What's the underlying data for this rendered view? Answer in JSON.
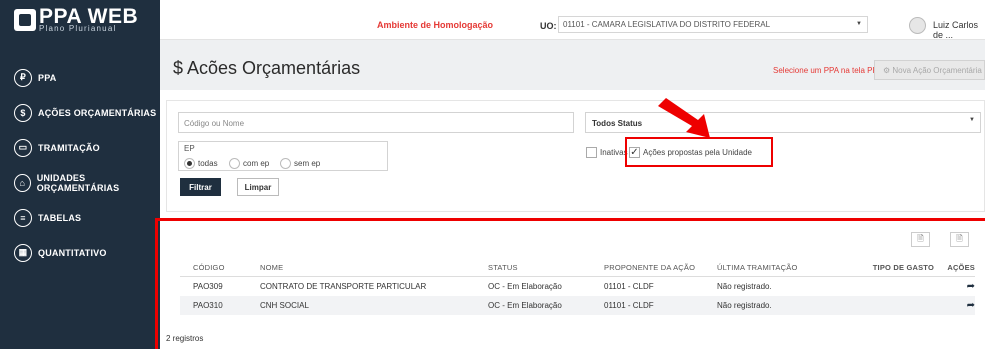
{
  "app": {
    "logo_main": "PPA WEB",
    "logo_sub": "Plano Plurianual"
  },
  "sidebar": {
    "items": [
      {
        "label": "PPA",
        "icon": "ppa-icon"
      },
      {
        "label": "AÇÕES ORÇAMENTÁRIAS",
        "icon": "dollar-icon"
      },
      {
        "label": "TRAMITAÇÃO",
        "icon": "tramitacao-icon"
      },
      {
        "label": "UNIDADES ORÇAMENTÁRIAS",
        "icon": "institution-icon"
      },
      {
        "label": "TABELAS",
        "icon": "list-icon"
      },
      {
        "label": "QUANTITATIVO",
        "icon": "chart-icon"
      }
    ]
  },
  "topbar": {
    "environment": "Ambiente de Homologação",
    "uo_label": "UO:",
    "uo_value": "01101 - CAMARA LEGISLATIVA DO DISTRITO FEDERAL",
    "user_name": "Luiz Carlos de ..."
  },
  "header": {
    "title": "$ Acões Orçamentárias",
    "hint": "Selecione um PPA na tela PPA",
    "new_action": "⚙ Nova Ação Orçamentária"
  },
  "filters": {
    "code_placeholder": "Código ou Nome",
    "status_value": "Todos Status",
    "ep_label": "EP",
    "ep_options": [
      "todas",
      "com ep",
      "sem ep"
    ],
    "ep_selected": "todas",
    "inactive_label": "Inativas",
    "proposed_label": "Ações propostas pela Unidade",
    "filter_button": "Filtrar",
    "clear_button": "Limpar"
  },
  "table": {
    "headers": [
      "CÓDIGO",
      "NOME",
      "STATUS",
      "PROPONENTE DA AÇÃO",
      "ÚLTIMA TRAMITAÇÃO",
      "TIPO DE GASTO",
      "AÇÕES"
    ],
    "rows": [
      {
        "code": "PAO309",
        "name": "CONTRATO DE TRANSPORTE PARTICULAR",
        "status": "OC - Em Elaboração",
        "proponent": "01101 - CLDF",
        "last": "Não registrado.",
        "type": ""
      },
      {
        "code": "PAO310",
        "name": "CNH SOCIAL",
        "status": "OC - Em Elaboração",
        "proponent": "01101 - CLDF",
        "last": "Não registrado.",
        "type": ""
      }
    ],
    "count": "2 registros"
  },
  "colors": {
    "sidebar": "#1f2f3f",
    "alert": "#e53935",
    "annotation": "#e00000"
  }
}
